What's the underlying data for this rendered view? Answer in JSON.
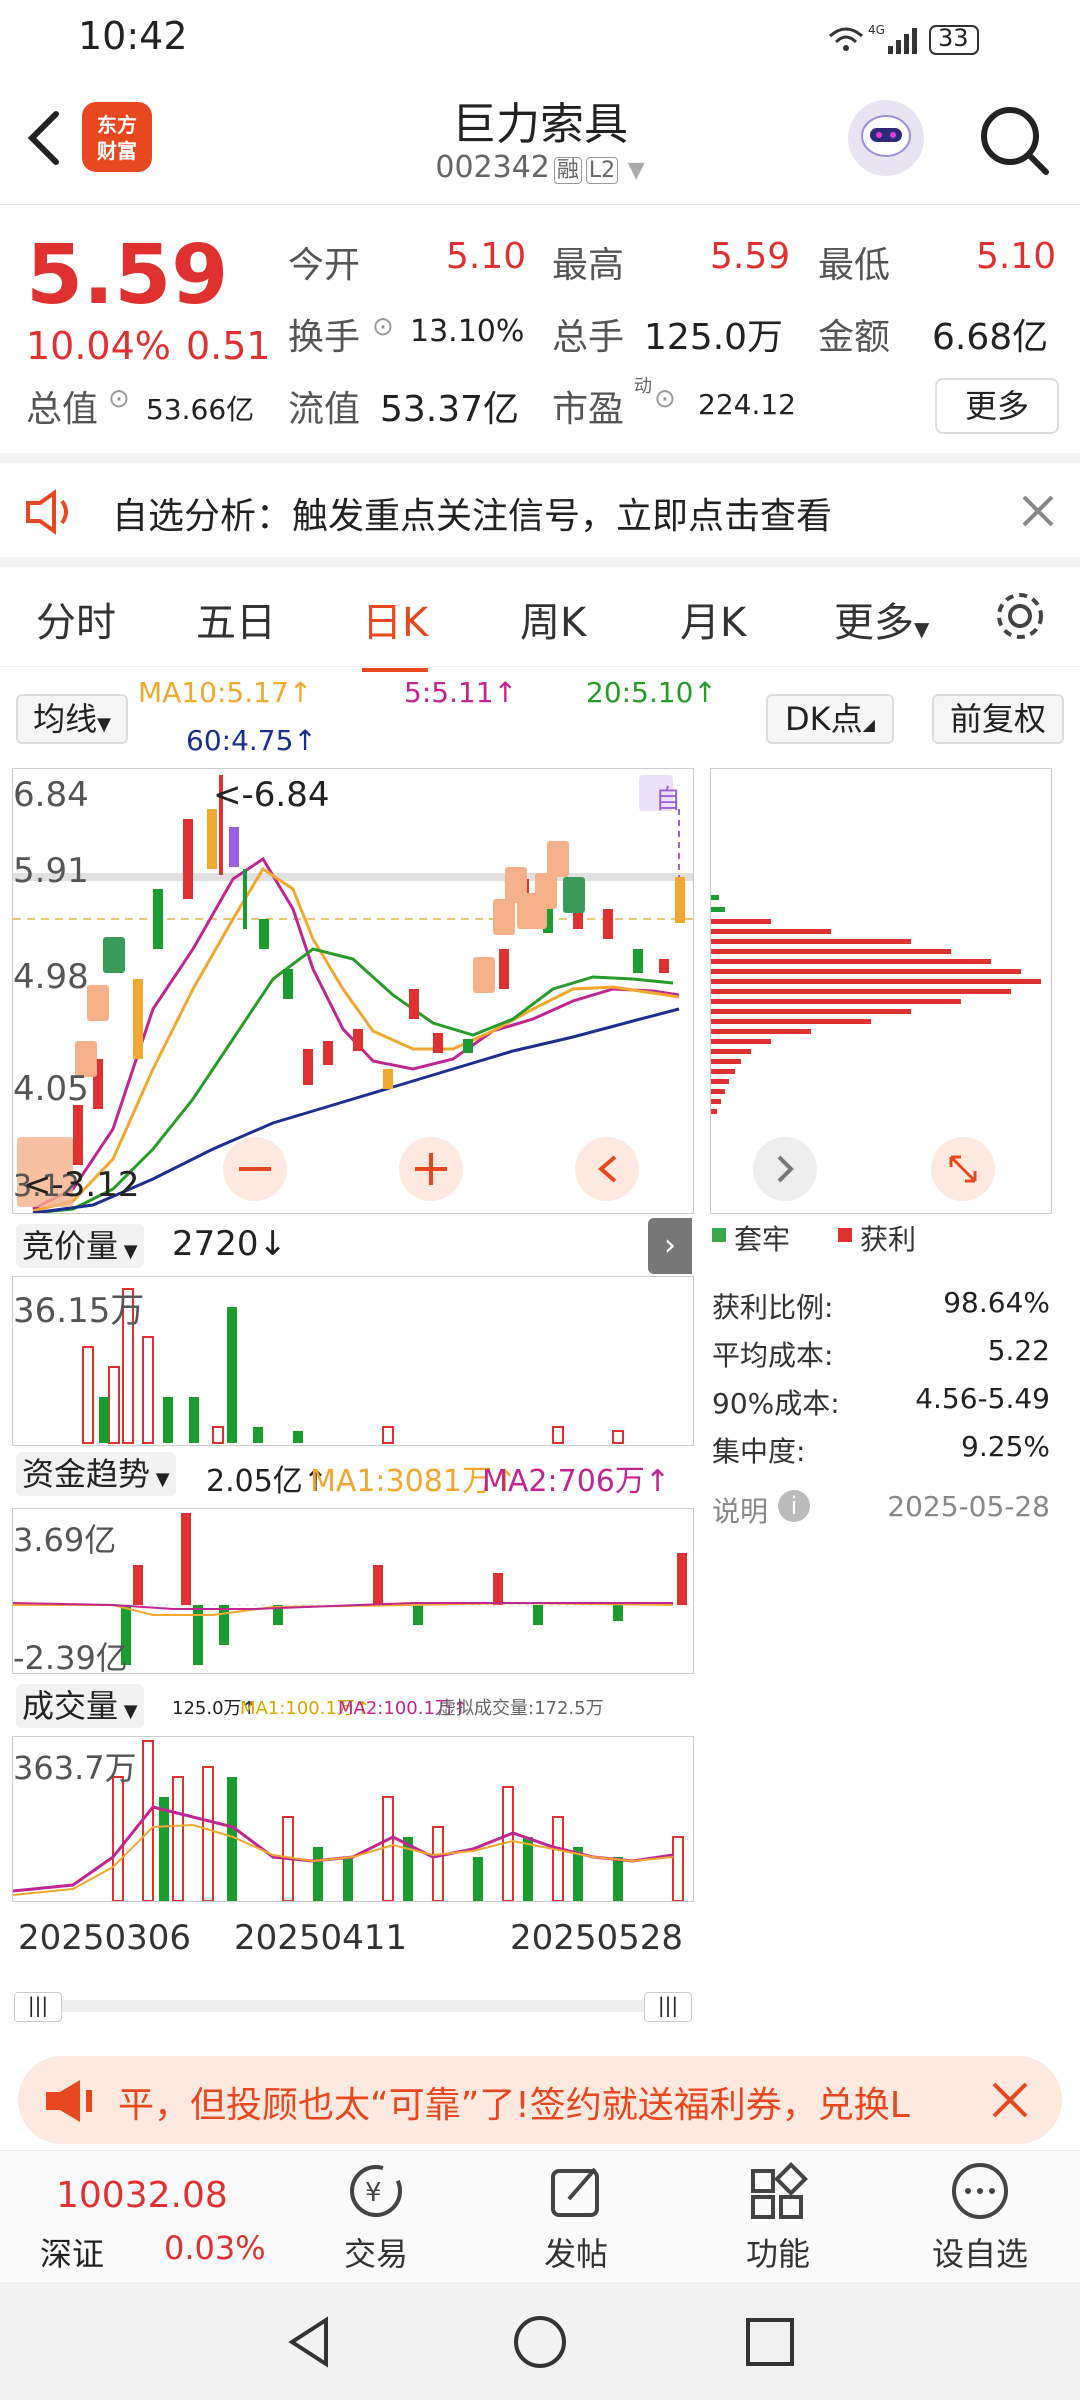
{
  "status": {
    "time": "10:42",
    "battery": "33",
    "network": "4G"
  },
  "header": {
    "logo_line1": "东方",
    "logo_line2": "财富",
    "stock_name": "巨力索具",
    "stock_code": "002342",
    "tag_margin": "融",
    "tag_level": "L2"
  },
  "quote": {
    "price": "5.59",
    "pct": "10.04%",
    "change": "0.51",
    "open_label": "今开",
    "open": "5.10",
    "high_label": "最高",
    "high": "5.59",
    "low_label": "最低",
    "low": "5.10",
    "turnover_label": "换手",
    "turnover": "13.10%",
    "volume_label": "总手",
    "volume": "125.0万",
    "amount_label": "金额",
    "amount": "6.68亿",
    "mktcap_label": "总值",
    "mktcap": "53.66亿",
    "float_label": "流值",
    "float": "53.37亿",
    "pe_label": "市盈",
    "pe_sup": "动",
    "pe": "224.12",
    "more": "更多"
  },
  "banner": {
    "text": "自选分析：触发重点关注信号，立即点击查看"
  },
  "tabs": [
    "分时",
    "五日",
    "日K",
    "周K",
    "月K",
    "更多"
  ],
  "kline": {
    "indicator": "均线",
    "ma10": "MA10:5.17↑",
    "ma5": "5:5.11↑",
    "ma20": "20:5.10↑",
    "ma60": "60:4.75↑",
    "dk_label": "DK点",
    "adjust_label": "前复权",
    "y_labels": [
      "6.84",
      "5.91",
      "4.98",
      "4.05",
      "3.12"
    ],
    "high_mark": "<-6.84",
    "low_mark": "<-3.12",
    "self_mark": "自"
  },
  "bid": {
    "label": "竞价量",
    "value": "2720↓",
    "max": "36.15万"
  },
  "fund": {
    "label": "资金趋势",
    "value": "2.05亿↑",
    "ma1": "MA1:3081万↑",
    "ma2": "MA2:706万↑",
    "max": "3.69亿",
    "min": "-2.39亿"
  },
  "vol": {
    "label": "成交量",
    "value": "125.0万↑",
    "ma1": "MA1:100.1万↑",
    "ma2": "MA2:100.1万↑",
    "virtual": "虚拟成交量:172.5万",
    "max": "363.7万"
  },
  "xaxis": [
    "20250306",
    "20250411",
    "20250528"
  ],
  "chips": {
    "legend_trap": "套牢",
    "legend_profit": "获利",
    "profit_ratio_label": "获利比例:",
    "profit_ratio": "98.64%",
    "avg_cost_label": "平均成本:",
    "avg_cost": "5.22",
    "cost90_label": "90%成本:",
    "cost90": "4.56-5.49",
    "concentration_label": "集中度:",
    "concentration": "9.25%",
    "note_label": "说明",
    "date": "2025-05-28"
  },
  "ad": {
    "text": "平，但投顾也太“可靠”了!签约就送福利券，兑换L"
  },
  "bottom": {
    "index_value": "10032.08",
    "index_name": "深证",
    "index_pct": "0.03%",
    "items": [
      "交易",
      "发帖",
      "功能",
      "设自选"
    ]
  },
  "colors": {
    "up": "#e03131",
    "down": "#1a9c2e",
    "accent": "#e8481f",
    "ma5": "#c0268f",
    "ma10": "#f0a830",
    "ma20": "#2a9a2a",
    "ma60": "#1c2f8c"
  }
}
